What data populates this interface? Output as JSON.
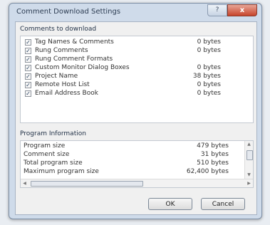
{
  "window": {
    "title": "Comment Download Settings",
    "help_label": "?",
    "close_label": "x"
  },
  "comments_group": {
    "label": "Comments to download",
    "items": [
      {
        "label": "Tag Names & Comments",
        "value": "0 bytes",
        "checked": true
      },
      {
        "label": "Rung Comments",
        "value": "0 bytes",
        "checked": true
      },
      {
        "label": "Rung Comment Formats",
        "value": "",
        "checked": true
      },
      {
        "label": "Custom Monitor Dialog Boxes",
        "value": "0 bytes",
        "checked": true
      },
      {
        "label": "Project Name",
        "value": "38 bytes",
        "checked": true
      },
      {
        "label": "Remote Host List",
        "value": "0 bytes",
        "checked": true
      },
      {
        "label": "Email Address Book",
        "value": "0 bytes",
        "checked": true
      }
    ]
  },
  "program_group": {
    "label": "Program Information",
    "rows": [
      {
        "label": "Program size",
        "value": "479 bytes"
      },
      {
        "label": "Comment size",
        "value": "31 bytes"
      },
      {
        "label": "Total program size",
        "value": "510 bytes"
      },
      {
        "label": "Maximum program size",
        "value": "62,400 bytes"
      }
    ]
  },
  "buttons": {
    "ok": "OK",
    "cancel": "Cancel"
  }
}
